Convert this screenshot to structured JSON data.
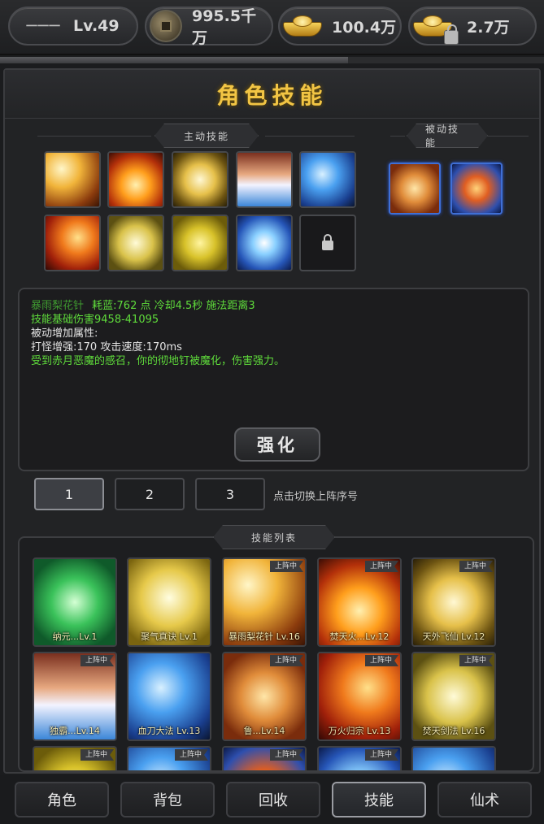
{
  "topbar": {
    "name": "一一一",
    "level": "Lv.49",
    "copper": "995.5千万",
    "gold": "100.4万",
    "bound_gold": "2.7万",
    "progress": 0.64
  },
  "panel": {
    "title": "角色技能",
    "active_tab_label": "主动技能",
    "passive_tab_label": "被动技能"
  },
  "active_skills": [
    "arrows",
    "flame",
    "sword",
    "spikes",
    "blue-slash",
    "meteor",
    "blade",
    "dragon",
    "ice-slash",
    "locked"
  ],
  "passive_skills": [
    "claw",
    "yinyang"
  ],
  "description": {
    "line1_name": "暴雨梨花针",
    "line1_rest": "耗蓝:762 点  冷却4.5秒  施法距离3",
    "line2": "技能基础伤害9458-41095",
    "line3": "被动增加属性:",
    "line4": "打怪增强:170    攻击速度:170ms",
    "line5": "受到赤月恶魔的感召，你的彻地钉被魔化，伤害强力。"
  },
  "strengthen_label": "强化",
  "formation": {
    "tabs": [
      "1",
      "2",
      "3"
    ],
    "active": "1",
    "hint": "点击切换上阵序号"
  },
  "skill_list": {
    "title": "技能列表",
    "badge": "上阵中",
    "cards": [
      {
        "label": "纳元...Lv.1",
        "icon": "taiji",
        "equipped": false
      },
      {
        "label": "聚气真诀 Lv.1",
        "icon": "meditate",
        "equipped": false
      },
      {
        "label": "暴雨梨花针 Lv.16",
        "icon": "arrows",
        "equipped": true
      },
      {
        "label": "焚天火...Lv.12",
        "icon": "flame",
        "equipped": true
      },
      {
        "label": "天外飞仙 Lv.12",
        "icon": "sword",
        "equipped": true
      },
      {
        "label": "独霸...Lv.14",
        "icon": "spikes",
        "equipped": true
      },
      {
        "label": "血刀大法 Lv.13",
        "icon": "blue-slash",
        "equipped": false
      },
      {
        "label": "鲁...Lv.14",
        "icon": "claw",
        "equipped": true
      },
      {
        "label": "万火归宗 Lv.13",
        "icon": "meteor",
        "equipped": true
      },
      {
        "label": "焚天剑法 Lv.16",
        "icon": "blade",
        "equipped": true
      },
      {
        "label": "",
        "icon": "dragon",
        "equipped": true
      },
      {
        "label": "",
        "icon": "blue-slash",
        "equipped": true
      },
      {
        "label": "",
        "icon": "yinyang",
        "equipped": true
      },
      {
        "label": "",
        "icon": "ice-slash",
        "equipped": true
      },
      {
        "label": "",
        "icon": "blue",
        "equipped": false
      }
    ]
  },
  "nav": {
    "items": [
      "角色",
      "背包",
      "回收",
      "技能",
      "仙术"
    ],
    "active": "技能"
  }
}
